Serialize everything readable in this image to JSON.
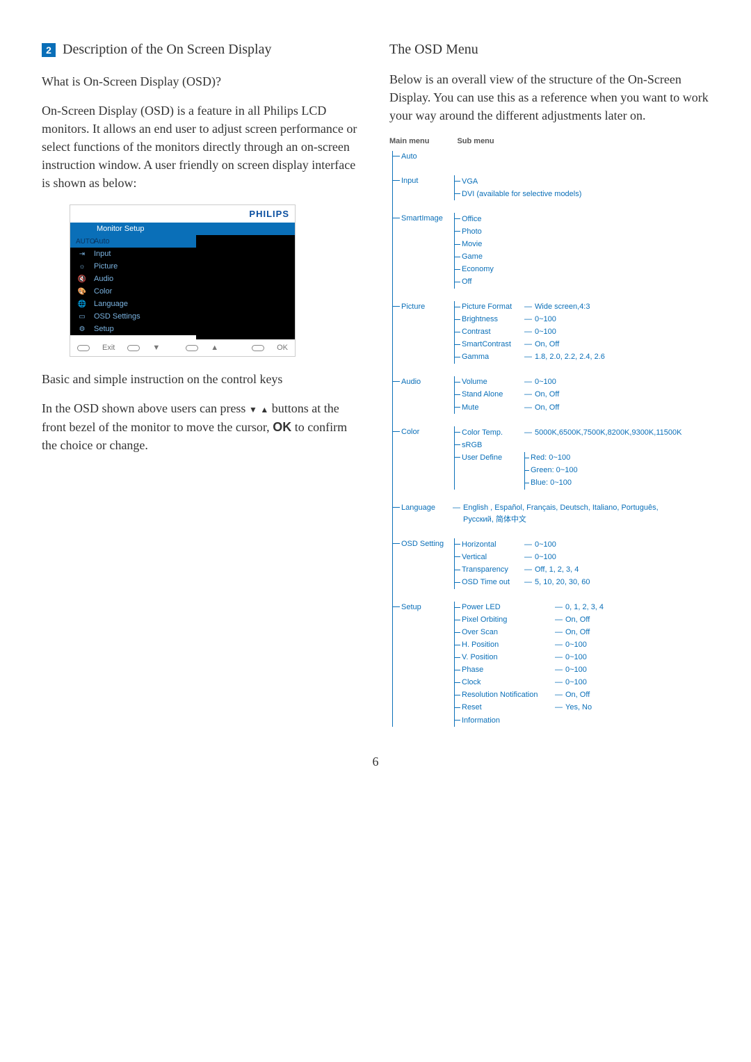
{
  "page_number": "6",
  "section_number": "2",
  "section_title": "Description of the On Screen Display",
  "q_head": "What is On-Screen Display (OSD)?",
  "q_body": "On-Screen Display (OSD) is a feature in all Philips LCD monitors. It allows an end user to adjust screen performance or select functions of the monitors directly through an on-screen instruction window. A user friendly on screen display interface is shown as below:",
  "osd": {
    "brand": "PHILIPS",
    "title": "Monitor Setup",
    "items": [
      {
        "icon": "AUTO",
        "label": "Auto",
        "selected": true
      },
      {
        "icon": "⇥",
        "label": "Input"
      },
      {
        "icon": "☼",
        "label": "Picture"
      },
      {
        "icon": "🔇",
        "label": "Audio"
      },
      {
        "icon": "🎨",
        "label": "Color"
      },
      {
        "icon": "🌐",
        "label": "Language"
      },
      {
        "icon": "▭",
        "label": "OSD Settings"
      },
      {
        "icon": "⚙",
        "label": "Setup"
      }
    ],
    "footer": {
      "exit": "Exit",
      "down": "▼",
      "up": "▲",
      "ok": "OK"
    }
  },
  "instr_head": "Basic and simple instruction on the control keys",
  "instr_body_a": "In the OSD shown above users can press ",
  "instr_body_b": " buttons at the front bezel of the monitor to move the cursor, ",
  "instr_ok": "OK",
  "instr_body_c": " to confirm the choice or change.",
  "right_head": "The OSD Menu",
  "right_body": "Below is an overall view of the structure of the On-Screen Display. You can use this as a reference when you want to work your way around the different adjustments later on.",
  "tree_head_main": "Main menu",
  "tree_head_sub": "Sub menu",
  "menu": [
    {
      "label": "Auto",
      "subs": []
    },
    {
      "label": "Input",
      "subs": [
        {
          "label": "VGA"
        },
        {
          "label": "DVI (available for selective models)"
        }
      ]
    },
    {
      "label": "SmartImage",
      "subs": [
        {
          "label": "Office"
        },
        {
          "label": "Photo"
        },
        {
          "label": "Movie"
        },
        {
          "label": "Game"
        },
        {
          "label": "Economy"
        },
        {
          "label": "Off"
        }
      ]
    },
    {
      "label": "Picture",
      "subs": [
        {
          "label": "Picture Format",
          "val": "Wide screen,4:3"
        },
        {
          "label": "Brightness",
          "val": "0~100"
        },
        {
          "label": "Contrast",
          "val": "0~100"
        },
        {
          "label": "SmartContrast",
          "val": "On, Off"
        },
        {
          "label": "Gamma",
          "val": "1.8, 2.0, 2.2, 2.4, 2.6"
        }
      ]
    },
    {
      "label": "Audio",
      "subs": [
        {
          "label": "Volume",
          "val": "0~100"
        },
        {
          "label": "Stand Alone",
          "val": "On, Off"
        },
        {
          "label": "Mute",
          "val": "On, Off"
        }
      ]
    },
    {
      "label": "Color",
      "subs": [
        {
          "label": "Color Temp.",
          "val": "5000K,6500K,7500K,8200K,9300K,11500K"
        },
        {
          "label": "sRGB"
        },
        {
          "label": "User Define",
          "lvl3": [
            "Red: 0~100",
            "Green: 0~100",
            "Blue: 0~100"
          ]
        }
      ]
    },
    {
      "label": "Language",
      "inline": "English , Español, Français, Deutsch, Italiano, Português, Русский, 简体中文"
    },
    {
      "label": "OSD Setting",
      "subs": [
        {
          "label": "Horizontal",
          "val": "0~100"
        },
        {
          "label": "Vertical",
          "val": "0~100"
        },
        {
          "label": "Transparency",
          "val": "Off, 1, 2, 3, 4"
        },
        {
          "label": "OSD Time out",
          "val": "5, 10, 20, 30, 60"
        }
      ]
    },
    {
      "label": "Setup",
      "subs": [
        {
          "label": "Power LED",
          "val": "0, 1, 2, 3, 4",
          "wide": true
        },
        {
          "label": "Pixel Orbiting",
          "val": "On, Off",
          "wide": true
        },
        {
          "label": "Over Scan",
          "val": "On, Off",
          "wide": true
        },
        {
          "label": "H. Position",
          "val": "0~100",
          "wide": true
        },
        {
          "label": "V. Position",
          "val": "0~100",
          "wide": true
        },
        {
          "label": "Phase",
          "val": "0~100",
          "wide": true
        },
        {
          "label": "Clock",
          "val": "0~100",
          "wide": true
        },
        {
          "label": "Resolution Notification",
          "val": "On, Off",
          "wide": true
        },
        {
          "label": "Reset",
          "val": "Yes, No",
          "wide": true
        },
        {
          "label": "Information",
          "wide": true
        }
      ]
    }
  ]
}
